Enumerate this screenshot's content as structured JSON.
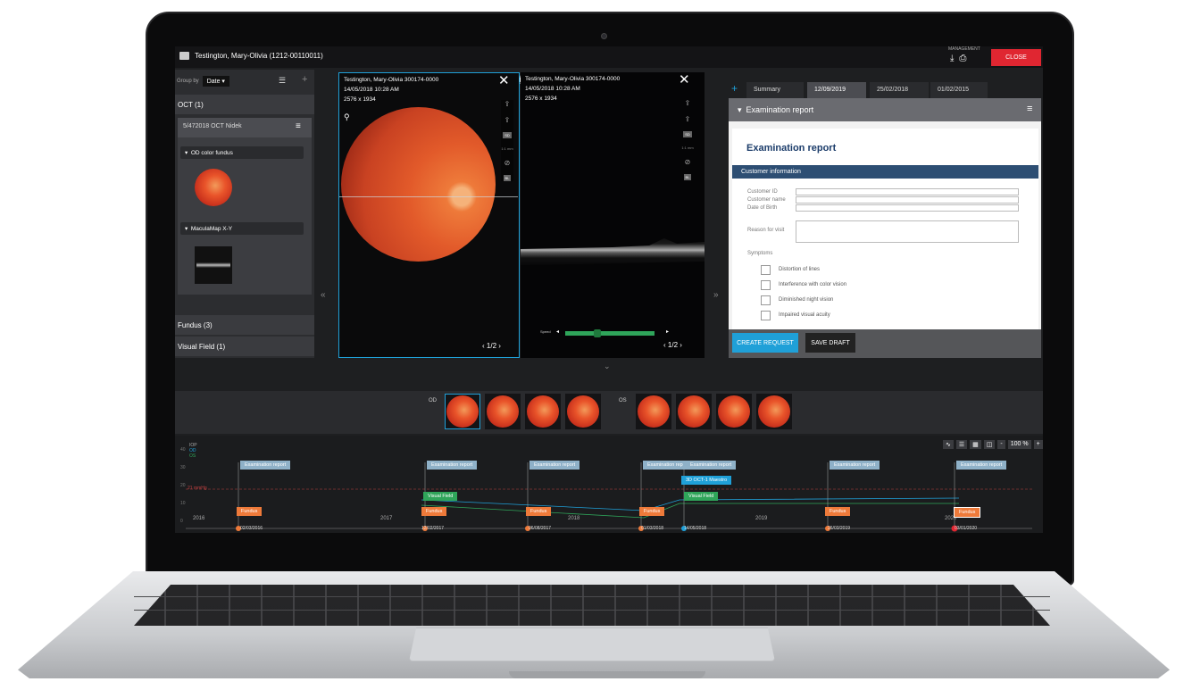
{
  "header": {
    "patient": "Testington, Mary-Olivia (1212-00110011)",
    "management_label": "MANAGEMENT",
    "close_label": "CLOSE"
  },
  "left_panel": {
    "group_by_label": "Group by",
    "group_by_value": "Date",
    "sections": [
      {
        "label": "OCT (1)"
      },
      {
        "label": "Fundus (3)"
      },
      {
        "label": "Visual Field (1)"
      }
    ],
    "oct_item": "5/472018 OCT Nidek",
    "images": [
      {
        "label": "OD color fundus"
      },
      {
        "label": "MaculaMap X-Y"
      }
    ]
  },
  "viewers": [
    {
      "patient": "Testington, Mary-Olivia 300174-0000",
      "datetime": "14/05/2018 10:28 AM",
      "resolution": "2576 x 1934",
      "page": "1/2",
      "badges": [
        "SD",
        "1:1 mm",
        "BL"
      ]
    },
    {
      "patient": "Testington, Mary-Olivia 300174-0000",
      "datetime": "14/05/2018 10:28 AM",
      "resolution": "2576 x 1934",
      "page": "1/2",
      "speed_label": "Speed",
      "badges": [
        "SD",
        "1:1 mm",
        "BL"
      ]
    }
  ],
  "tabs": [
    "Summary",
    "12/09/2019",
    "25/02/2018",
    "01/02/2015"
  ],
  "report": {
    "header": "Examination report",
    "title": "Examination report",
    "section": "Customer information",
    "fields": [
      "Customer ID",
      "Customer name",
      "Date of Birth"
    ],
    "reason_label": "Reason for visit",
    "symptoms_label": "Symptoms",
    "symptoms": [
      "Distortion of lines",
      "Interference with color vision",
      "Diminished night vision",
      "Impaired visual acuity"
    ],
    "create_btn": "CREATE REQUEST",
    "draft_btn": "SAVE DRAFT"
  },
  "strip": {
    "od_label": "OD",
    "os_label": "OS"
  },
  "timeline": {
    "legend": [
      "IOP",
      "OD",
      "OS"
    ],
    "y_ticks": [
      "40",
      "30",
      "20",
      "10",
      "0"
    ],
    "threshold_label": "21 mmHg",
    "years": [
      "2016",
      "2017",
      "2018",
      "2019",
      "2020"
    ],
    "zoom": "100 %",
    "tags": {
      "exam": "Examination report",
      "exam_short": "Examination rep",
      "fundus": "Fundus",
      "vf": "Visual Field",
      "oct": "3D OCT-1 Maestro"
    },
    "dates": [
      "02/03/2016",
      "12/02/2017",
      "06/08/2017",
      "01/03/2018",
      "14/05/2018",
      "26/03/2019",
      "03/01/2020"
    ]
  },
  "colors": {
    "accent": "#1fa0d8",
    "close": "#e02631",
    "fundus_tag": "#ee7a3a",
    "vf_tag": "#2fa55a",
    "exam_tag": "#8fb1c8"
  }
}
